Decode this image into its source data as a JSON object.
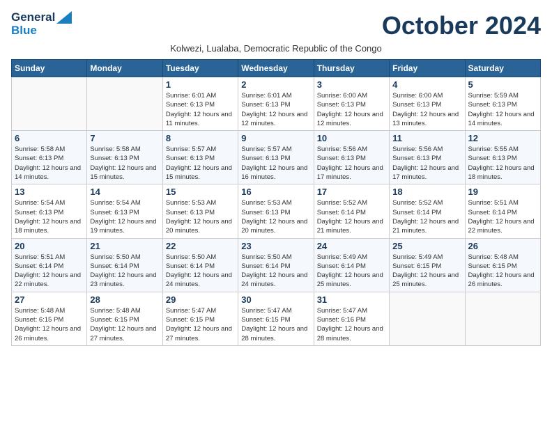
{
  "header": {
    "logo_general": "General",
    "logo_blue": "Blue",
    "month_title": "October 2024",
    "subtitle": "Kolwezi, Lualaba, Democratic Republic of the Congo"
  },
  "weekdays": [
    "Sunday",
    "Monday",
    "Tuesday",
    "Wednesday",
    "Thursday",
    "Friday",
    "Saturday"
  ],
  "weeks": [
    [
      {
        "day": "",
        "info": ""
      },
      {
        "day": "",
        "info": ""
      },
      {
        "day": "1",
        "info": "Sunrise: 6:01 AM\nSunset: 6:13 PM\nDaylight: 12 hours and 11 minutes."
      },
      {
        "day": "2",
        "info": "Sunrise: 6:01 AM\nSunset: 6:13 PM\nDaylight: 12 hours and 12 minutes."
      },
      {
        "day": "3",
        "info": "Sunrise: 6:00 AM\nSunset: 6:13 PM\nDaylight: 12 hours and 12 minutes."
      },
      {
        "day": "4",
        "info": "Sunrise: 6:00 AM\nSunset: 6:13 PM\nDaylight: 12 hours and 13 minutes."
      },
      {
        "day": "5",
        "info": "Sunrise: 5:59 AM\nSunset: 6:13 PM\nDaylight: 12 hours and 14 minutes."
      }
    ],
    [
      {
        "day": "6",
        "info": "Sunrise: 5:58 AM\nSunset: 6:13 PM\nDaylight: 12 hours and 14 minutes."
      },
      {
        "day": "7",
        "info": "Sunrise: 5:58 AM\nSunset: 6:13 PM\nDaylight: 12 hours and 15 minutes."
      },
      {
        "day": "8",
        "info": "Sunrise: 5:57 AM\nSunset: 6:13 PM\nDaylight: 12 hours and 15 minutes."
      },
      {
        "day": "9",
        "info": "Sunrise: 5:57 AM\nSunset: 6:13 PM\nDaylight: 12 hours and 16 minutes."
      },
      {
        "day": "10",
        "info": "Sunrise: 5:56 AM\nSunset: 6:13 PM\nDaylight: 12 hours and 17 minutes."
      },
      {
        "day": "11",
        "info": "Sunrise: 5:56 AM\nSunset: 6:13 PM\nDaylight: 12 hours and 17 minutes."
      },
      {
        "day": "12",
        "info": "Sunrise: 5:55 AM\nSunset: 6:13 PM\nDaylight: 12 hours and 18 minutes."
      }
    ],
    [
      {
        "day": "13",
        "info": "Sunrise: 5:54 AM\nSunset: 6:13 PM\nDaylight: 12 hours and 18 minutes."
      },
      {
        "day": "14",
        "info": "Sunrise: 5:54 AM\nSunset: 6:13 PM\nDaylight: 12 hours and 19 minutes."
      },
      {
        "day": "15",
        "info": "Sunrise: 5:53 AM\nSunset: 6:13 PM\nDaylight: 12 hours and 20 minutes."
      },
      {
        "day": "16",
        "info": "Sunrise: 5:53 AM\nSunset: 6:13 PM\nDaylight: 12 hours and 20 minutes."
      },
      {
        "day": "17",
        "info": "Sunrise: 5:52 AM\nSunset: 6:14 PM\nDaylight: 12 hours and 21 minutes."
      },
      {
        "day": "18",
        "info": "Sunrise: 5:52 AM\nSunset: 6:14 PM\nDaylight: 12 hours and 21 minutes."
      },
      {
        "day": "19",
        "info": "Sunrise: 5:51 AM\nSunset: 6:14 PM\nDaylight: 12 hours and 22 minutes."
      }
    ],
    [
      {
        "day": "20",
        "info": "Sunrise: 5:51 AM\nSunset: 6:14 PM\nDaylight: 12 hours and 22 minutes."
      },
      {
        "day": "21",
        "info": "Sunrise: 5:50 AM\nSunset: 6:14 PM\nDaylight: 12 hours and 23 minutes."
      },
      {
        "day": "22",
        "info": "Sunrise: 5:50 AM\nSunset: 6:14 PM\nDaylight: 12 hours and 24 minutes."
      },
      {
        "day": "23",
        "info": "Sunrise: 5:50 AM\nSunset: 6:14 PM\nDaylight: 12 hours and 24 minutes."
      },
      {
        "day": "24",
        "info": "Sunrise: 5:49 AM\nSunset: 6:14 PM\nDaylight: 12 hours and 25 minutes."
      },
      {
        "day": "25",
        "info": "Sunrise: 5:49 AM\nSunset: 6:15 PM\nDaylight: 12 hours and 25 minutes."
      },
      {
        "day": "26",
        "info": "Sunrise: 5:48 AM\nSunset: 6:15 PM\nDaylight: 12 hours and 26 minutes."
      }
    ],
    [
      {
        "day": "27",
        "info": "Sunrise: 5:48 AM\nSunset: 6:15 PM\nDaylight: 12 hours and 26 minutes."
      },
      {
        "day": "28",
        "info": "Sunrise: 5:48 AM\nSunset: 6:15 PM\nDaylight: 12 hours and 27 minutes."
      },
      {
        "day": "29",
        "info": "Sunrise: 5:47 AM\nSunset: 6:15 PM\nDaylight: 12 hours and 27 minutes."
      },
      {
        "day": "30",
        "info": "Sunrise: 5:47 AM\nSunset: 6:15 PM\nDaylight: 12 hours and 28 minutes."
      },
      {
        "day": "31",
        "info": "Sunrise: 5:47 AM\nSunset: 6:16 PM\nDaylight: 12 hours and 28 minutes."
      },
      {
        "day": "",
        "info": ""
      },
      {
        "day": "",
        "info": ""
      }
    ]
  ]
}
